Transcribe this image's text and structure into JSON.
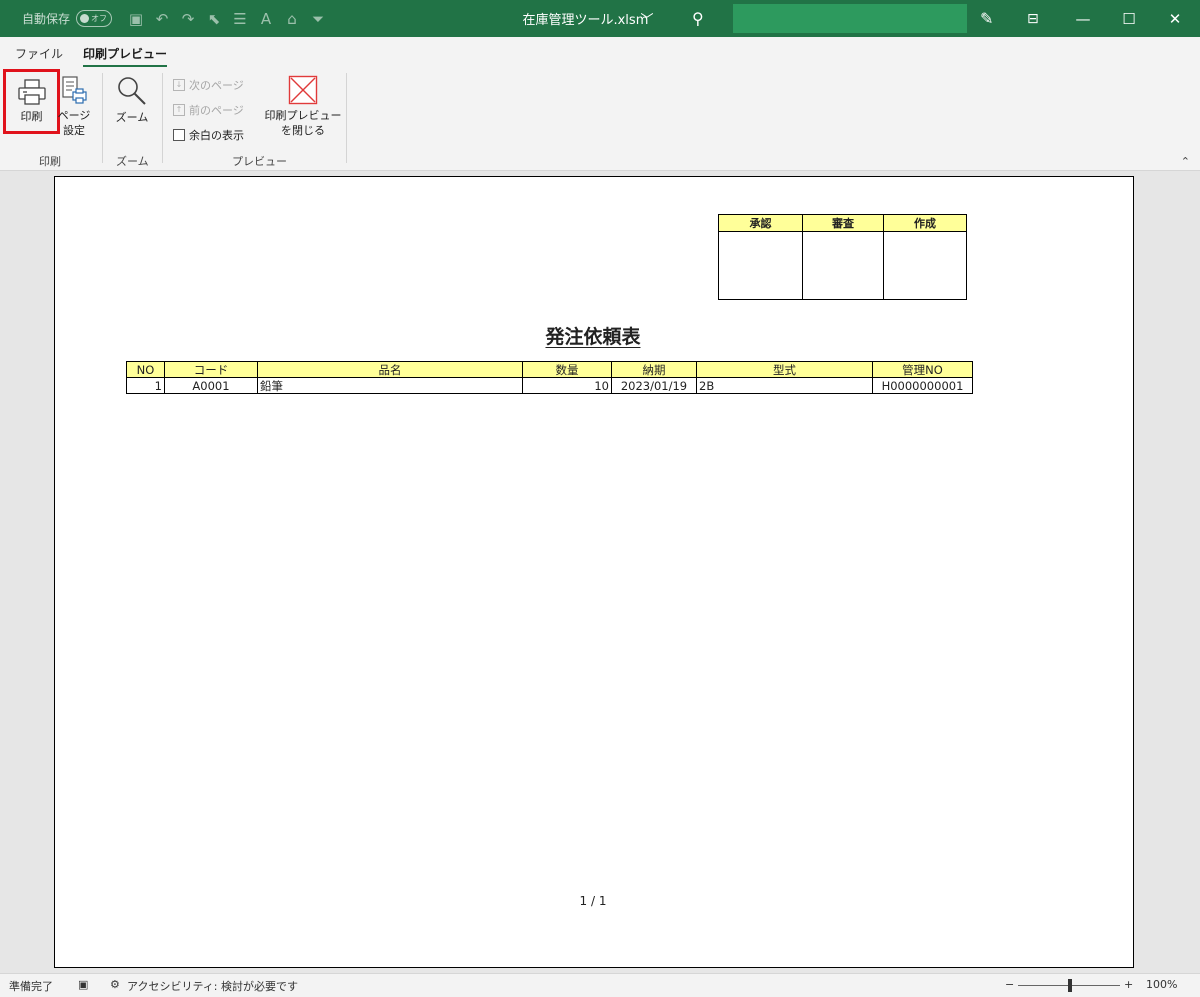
{
  "titlebar": {
    "autosave_label": "自動保存",
    "autosave_state": "オフ",
    "file_name": "在庫管理ツール.xlsm",
    "title_chevron": "﹀"
  },
  "tabs": [
    {
      "label": "ファイル"
    },
    {
      "label": "印刷プレビュー",
      "active": true
    }
  ],
  "ribbon": {
    "print_label": "印刷",
    "page_setup_label_1": "ページ",
    "page_setup_label_2": "設定",
    "zoom_label": "ズーム",
    "next_page_label": "次のページ",
    "prev_page_label": "前のページ",
    "show_margins_label": "余白の表示",
    "close_preview_label_1": "印刷プレビュー",
    "close_preview_label_2": "を閉じる",
    "group_print": "印刷",
    "group_zoom": "ズーム",
    "group_preview": "プレビュー"
  },
  "document": {
    "approval_headers": [
      "承認",
      "審査",
      "作成"
    ],
    "heading": "発注依頼表",
    "table_headers": [
      "NO",
      "コード",
      "品名",
      "数量",
      "納期",
      "型式",
      "管理NO"
    ],
    "rows": [
      {
        "no": "1",
        "code": "A0001",
        "name": "鉛筆",
        "qty": "10",
        "due": "2023/01/19",
        "model": "2B",
        "mgmt_no": "H0000000001"
      }
    ],
    "page_indicator": "1 / 1"
  },
  "statusbar": {
    "ready": "準備完了",
    "accessibility": "アクセシビリティ: 検討が必要です",
    "zoom_minus": "−",
    "zoom_plus": "+",
    "zoom_level": "100%",
    "zoom_fraction": 0.5
  },
  "colors": {
    "title_green": "#217346",
    "header_yellow": "#ffff99",
    "highlight_red": "#e0121b"
  }
}
